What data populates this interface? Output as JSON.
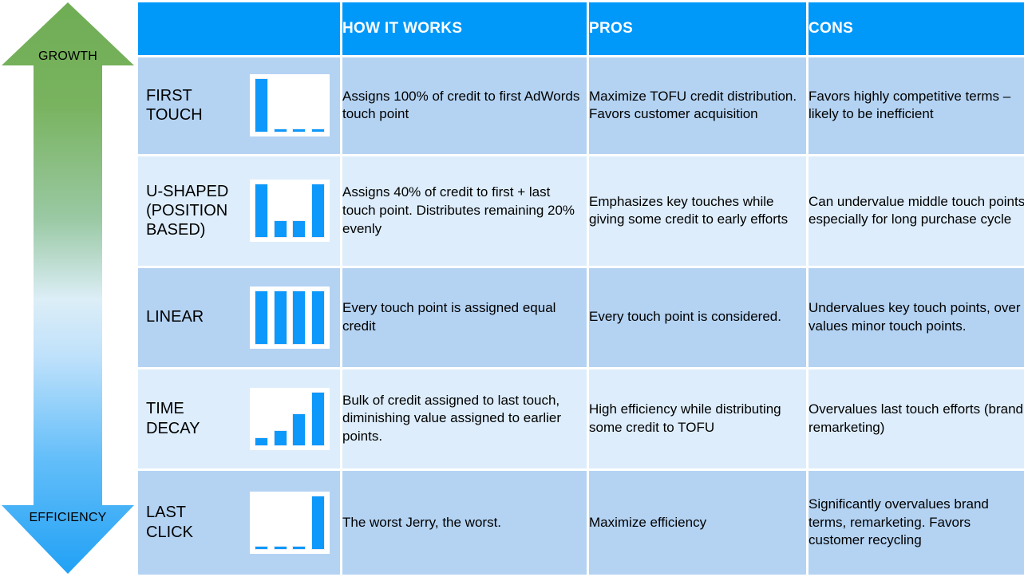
{
  "axis": {
    "top_label": "GROWTH",
    "bottom_label": "EFFICIENCY",
    "top_color": "#6fad55",
    "bottom_color": "#2ba5f7"
  },
  "table": {
    "headers": {
      "model": "",
      "how_it_works": "HOW IT WORKS",
      "pros": "PROS",
      "cons": "CONS"
    },
    "header_bg": "#0099fa",
    "row_bg_odd": "#b4d3f3",
    "row_bg_even": "#ddedfb",
    "bar_color": "#0d98fb",
    "rows": [
      {
        "model": "FIRST\nTOUCH",
        "chart": {
          "type": "bar",
          "values": [
            100,
            6,
            6,
            6
          ],
          "ylim": [
            0,
            100
          ]
        },
        "how_it_works": "Assigns 100% of credit to first AdWords touch point",
        "pros": "Maximize TOFU credit distribution. Favors customer acquisition",
        "cons": "Favors highly competitive terms – likely to be inefficient"
      },
      {
        "model": "U-SHAPED\n(POSITION\nBASED)",
        "chart": {
          "type": "bar",
          "values": [
            100,
            33,
            33,
            100
          ],
          "ylim": [
            0,
            100
          ]
        },
        "how_it_works": "Assigns 40% of credit to first + last touch point. Distributes remaining 20% evenly",
        "pros": "Emphasizes key touches while giving some credit to early efforts",
        "cons": "Can undervalue middle touch points, especially for long purchase cycle"
      },
      {
        "model": "LINEAR",
        "chart": {
          "type": "bar",
          "values": [
            100,
            100,
            100,
            100
          ],
          "ylim": [
            0,
            100
          ]
        },
        "how_it_works": "Every touch point is assigned equal credit",
        "pros": "Every touch point is considered.",
        "cons": "Undervalues key touch points, over values minor touch points."
      },
      {
        "model": "TIME\nDECAY",
        "chart": {
          "type": "bar",
          "values": [
            16,
            30,
            60,
            100
          ],
          "ylim": [
            0,
            100
          ]
        },
        "how_it_works": "Bulk of credit assigned to last touch, diminishing value assigned to earlier points.",
        "pros": "High efficiency while distributing some credit to TOFU",
        "cons": "Overvalues last touch efforts (brand, remarketing)"
      },
      {
        "model": "LAST\nCLICK",
        "chart": {
          "type": "bar",
          "values": [
            6,
            6,
            6,
            100
          ],
          "ylim": [
            0,
            100
          ]
        },
        "how_it_works": "The worst Jerry, the worst.",
        "pros": "Maximize efficiency",
        "cons": "Significantly overvalues brand terms, remarketing. Favors customer recycling"
      }
    ]
  }
}
